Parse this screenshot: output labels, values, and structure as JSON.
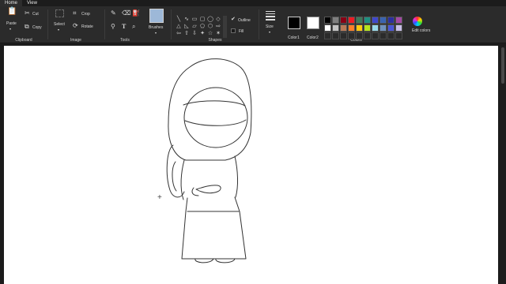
{
  "tabs": [
    "Home",
    "View"
  ],
  "clipboard": {
    "paste": "Paste",
    "cut": "Cut",
    "copy": "Copy",
    "label": "Clipboard"
  },
  "image": {
    "select": "Select",
    "crop": "Crop",
    "rotate": "Rotate",
    "label": "Image"
  },
  "tools": {
    "label": "Tools",
    "icons": [
      "pencil-icon",
      "eraser-icon",
      "fill-bucket-icon",
      "color-picker-icon",
      "text-icon",
      "magnifier-icon"
    ]
  },
  "brushes": {
    "label": "Brushes"
  },
  "shapes": {
    "label": "Shapes",
    "outline": "Outline",
    "fill": "Fill",
    "glyphs": [
      "╲",
      "∿",
      "▭",
      "▢",
      "◯",
      "◇",
      "△",
      "◺",
      "▱",
      "⬠",
      "⬡",
      "⇨",
      "⇦",
      "⇧",
      "⇩",
      "✦",
      "☆",
      "✶"
    ]
  },
  "size": {
    "label": "Size"
  },
  "colors": {
    "label": "Colors",
    "color1": "Color1",
    "color2": "Color2",
    "edit": "Edit colors",
    "color1_value": "#000000",
    "color2_value": "#ffffff",
    "palette": [
      "#000000",
      "#7f7f7f",
      "#880015",
      "#ed1c24",
      "#3d7a5a",
      "#1f8f80",
      "#3f48cc",
      "#3a63b0",
      "#2b2fa0",
      "#a349a4",
      "#ffffff",
      "#c3c3c3",
      "#b97a57",
      "#ff7f27",
      "#ffc90e",
      "#b5e61d",
      "#99d9ea",
      "#7092be",
      "#4a55d8",
      "#c8bfe7",
      "",
      "",
      "",
      "",
      "",
      "",
      "",
      "",
      "",
      ""
    ]
  }
}
